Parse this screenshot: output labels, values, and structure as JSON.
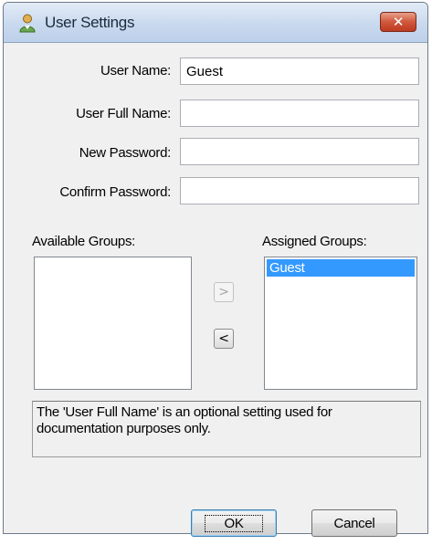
{
  "window": {
    "title": "User Settings",
    "close_icon": "✕"
  },
  "form": {
    "user_name_label": "User Name:",
    "user_name_value": "Guest",
    "user_full_name_label": "User Full Name:",
    "user_full_name_value": "",
    "new_password_label": "New Password:",
    "new_password_value": "",
    "confirm_password_label": "Confirm Password:",
    "confirm_password_value": ""
  },
  "groups": {
    "available_label": "Available Groups:",
    "available_items": [],
    "assigned_label": "Assigned Groups:",
    "assigned_items": [
      "Guest"
    ],
    "add_glyph": ">",
    "remove_glyph": "<"
  },
  "info": {
    "text": "The 'User Full Name' is an optional setting used for documentation purposes only."
  },
  "buttons": {
    "ok_label": "OK",
    "cancel_label": "Cancel"
  },
  "colors": {
    "selection": "#3399ff",
    "close_button": "#d0573c"
  }
}
